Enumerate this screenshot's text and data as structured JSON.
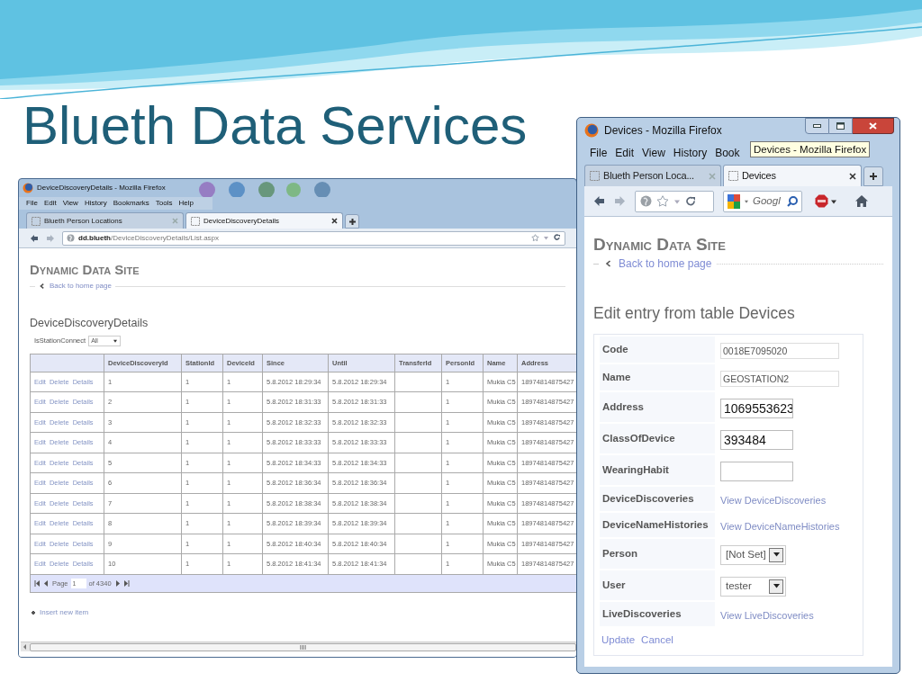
{
  "slide": {
    "title": "Blueth Data Services"
  },
  "list_window": {
    "title": "DeviceDiscoveryDetails - Mozilla Firefox",
    "menu": [
      "File",
      "Edit",
      "View",
      "History",
      "Bookmarks",
      "Tools",
      "Help"
    ],
    "tabs": [
      {
        "label": "Blueth Person Locations",
        "selected": false
      },
      {
        "label": "DeviceDiscoveryDetails",
        "selected": true
      }
    ],
    "url_host": "dd.blueth",
    "url_path": "/DeviceDiscoveryDetails/List.aspx",
    "site_title": "Dynamic Data Site",
    "back_link": "Back to home page",
    "heading": "DeviceDiscoveryDetails",
    "filter": {
      "label": "IsStationConnect",
      "value": "All"
    },
    "table": {
      "columns": [
        "DeviceDiscoveryId",
        "StationId",
        "DeviceId",
        "Since",
        "Until",
        "TransferId",
        "PersonId",
        "Name",
        "Address"
      ],
      "rows": [
        {
          "actions": [
            "Edit",
            "Delete",
            "Details"
          ],
          "cells": [
            "1",
            "1",
            "1",
            "5.8.2012 18:29:34",
            "5.8.2012 18:29:34",
            "",
            "1",
            "Mukia C5",
            "18974814875427"
          ]
        },
        {
          "actions": [
            "Edit",
            "Delete",
            "Details"
          ],
          "cells": [
            "2",
            "1",
            "1",
            "5.8.2012 18:31:33",
            "5.8.2012 18:31:33",
            "",
            "1",
            "Mukia C5",
            "18974814875427"
          ]
        },
        {
          "actions": [
            "Edit",
            "Delete",
            "Details"
          ],
          "cells": [
            "3",
            "1",
            "1",
            "5.8.2012 18:32:33",
            "5.8.2012 18:32:33",
            "",
            "1",
            "Mukia C5",
            "18974814875427"
          ]
        },
        {
          "actions": [
            "Edit",
            "Delete",
            "Details"
          ],
          "cells": [
            "4",
            "1",
            "1",
            "5.8.2012 18:33:33",
            "5.8.2012 18:33:33",
            "",
            "1",
            "Mukia C5",
            "18974814875427"
          ]
        },
        {
          "actions": [
            "Edit",
            "Delete",
            "Details"
          ],
          "cells": [
            "5",
            "1",
            "1",
            "5.8.2012 18:34:33",
            "5.8.2012 18:34:33",
            "",
            "1",
            "Mukia C5",
            "18974814875427"
          ]
        },
        {
          "actions": [
            "Edit",
            "Delete",
            "Details"
          ],
          "cells": [
            "6",
            "1",
            "1",
            "5.8.2012 18:36:34",
            "5.8.2012 18:36:34",
            "",
            "1",
            "Mukia C5",
            "18974814875427"
          ]
        },
        {
          "actions": [
            "Edit",
            "Delete",
            "Details"
          ],
          "cells": [
            "7",
            "1",
            "1",
            "5.8.2012 18:38:34",
            "5.8.2012 18:38:34",
            "",
            "1",
            "Mukia C5",
            "18974814875427"
          ]
        },
        {
          "actions": [
            "Edit",
            "Delete",
            "Details"
          ],
          "cells": [
            "8",
            "1",
            "1",
            "5.8.2012 18:39:34",
            "5.8.2012 18:39:34",
            "",
            "1",
            "Mukia C5",
            "18974814875427"
          ]
        },
        {
          "actions": [
            "Edit",
            "Delete",
            "Details"
          ],
          "cells": [
            "9",
            "1",
            "1",
            "5.8.2012 18:40:34",
            "5.8.2012 18:40:34",
            "",
            "1",
            "Mukia C5",
            "18974814875427"
          ]
        },
        {
          "actions": [
            "Edit",
            "Delete",
            "Details"
          ],
          "cells": [
            "10",
            "1",
            "1",
            "5.8.2012 18:41:34",
            "5.8.2012 18:41:34",
            "",
            "1",
            "Mukia C5",
            "18974814875427"
          ]
        }
      ]
    },
    "pager": {
      "label": "Page",
      "value": "1",
      "total": "of 4340"
    },
    "insert_link": "Insert new item"
  },
  "edit_window": {
    "title": "Devices - Mozilla Firefox",
    "menu": [
      "File",
      "Edit",
      "View",
      "History",
      "Book"
    ],
    "tooltip": "Devices - Mozilla Firefox",
    "tabs": [
      {
        "label": "Blueth Person Loca...",
        "selected": false
      },
      {
        "label": "Devices",
        "selected": true
      }
    ],
    "search": {
      "placeholder": "Googl"
    },
    "site_title": "Dynamic Data Site",
    "back_link": "Back to home page",
    "heading": "Edit entry from table Devices",
    "fields": [
      {
        "label": "Code",
        "kind": "text",
        "value": "0018E7095020"
      },
      {
        "label": "Name",
        "kind": "text",
        "value": "GEOSTATION2"
      },
      {
        "label": "Address",
        "kind": "bigtext",
        "value": "1069553623"
      },
      {
        "label": "ClassOfDevice",
        "kind": "bigtext",
        "value": "393484"
      },
      {
        "label": "WearingHabit",
        "kind": "bigtext"
      },
      {
        "label": "DeviceDiscoveries",
        "kind": "link",
        "value": "View DeviceDiscoveries"
      },
      {
        "label": "DeviceNameHistories",
        "kind": "link",
        "value": "View DeviceNameHistories"
      },
      {
        "label": "Person",
        "kind": "select",
        "value": "[Not Set]"
      },
      {
        "label": "User",
        "kind": "select",
        "value": "tester"
      },
      {
        "label": "LiveDiscoveries",
        "kind": "link",
        "value": "View LiveDiscoveries"
      }
    ],
    "buttons": [
      "Update",
      "Cancel"
    ]
  }
}
